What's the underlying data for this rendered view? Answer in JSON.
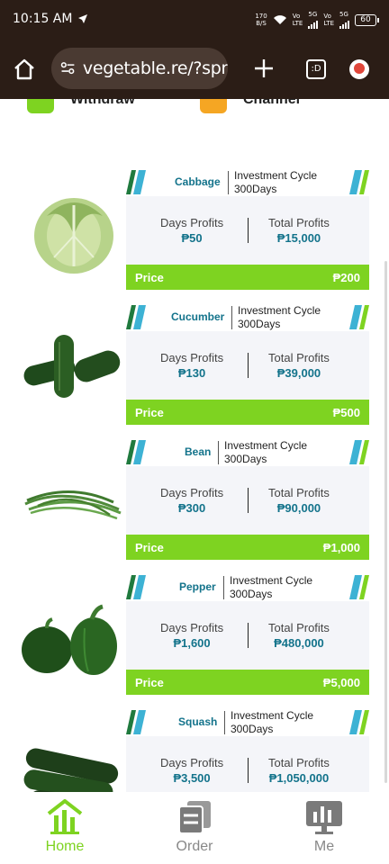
{
  "status_bar": {
    "time": "10:15 AM",
    "speed_value": "170",
    "speed_unit": "B/S",
    "sim1_top": "Vo",
    "sim1_bottom": "LTE",
    "sim1_gen": "5G",
    "sim2_top": "Vo",
    "sim2_bottom": "LTE",
    "sim2_gen": "5G",
    "battery": "60"
  },
  "browser": {
    "url": "vegetable.re/?spr",
    "tabs_label": ":D"
  },
  "shortcuts": [
    {
      "label": "Withdraw",
      "icon": "withdraw-icon",
      "color": "#7ed321"
    },
    {
      "label": "Channel",
      "icon": "channel-icon",
      "color": "#f5a623"
    }
  ],
  "labels": {
    "investment_cycle": "Investment Cycle",
    "days_profits": "Days Profits",
    "total_profits": "Total Profits",
    "price": "Price"
  },
  "products": [
    {
      "name": "Cabbage",
      "cycle": "300Days",
      "days_profit": "₱50",
      "total_profit": "₱15,000",
      "price": "₱200"
    },
    {
      "name": "Cucumber",
      "cycle": "300Days",
      "days_profit": "₱130",
      "total_profit": "₱39,000",
      "price": "₱500"
    },
    {
      "name": "Bean",
      "cycle": "300Days",
      "days_profit": "₱300",
      "total_profit": "₱90,000",
      "price": "₱1,000"
    },
    {
      "name": "Pepper",
      "cycle": "300Days",
      "days_profit": "₱1,600",
      "total_profit": "₱480,000",
      "price": "₱5,000"
    },
    {
      "name": "Squash",
      "cycle": "300Days",
      "days_profit": "₱3,500",
      "total_profit": "₱1,050,000",
      "price": ""
    }
  ],
  "nav": {
    "home": "Home",
    "order": "Order",
    "me": "Me"
  },
  "colors": {
    "accent_green": "#7ed321",
    "teal": "#13738b",
    "browser_bg": "#2b1d16"
  }
}
